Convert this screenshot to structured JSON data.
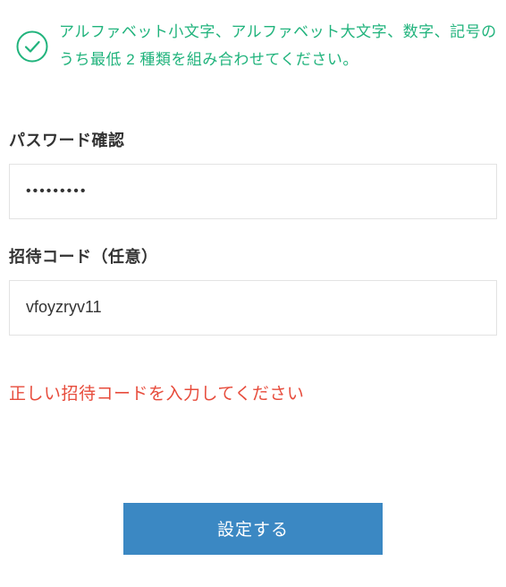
{
  "validation": {
    "message": "アルファベット小文字、アルファベット大文字、数字、記号のうち最低 2 種類を組み合わせてください。"
  },
  "password_confirm": {
    "label": "パスワード確認",
    "value": "•••••••••"
  },
  "invite_code": {
    "label": "招待コード（任意）",
    "value": "vfoyzryv11"
  },
  "error": {
    "message": "正しい招待コードを入力してください"
  },
  "submit": {
    "label": "設定する"
  },
  "colors": {
    "success": "#20b37c",
    "error": "#e74c3c",
    "primary_button": "#3b88c3"
  }
}
